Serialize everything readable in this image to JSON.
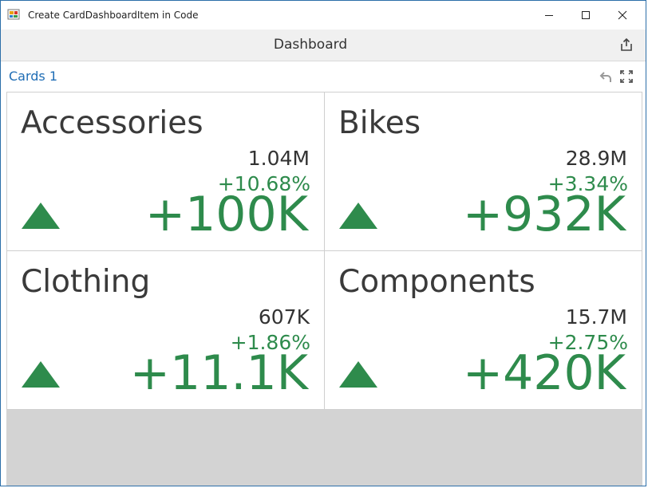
{
  "window": {
    "title": "Create CardDashboardItem in Code"
  },
  "toolbar": {
    "title": "Dashboard"
  },
  "item": {
    "title": "Cards 1"
  },
  "colors": {
    "positive": "#2e8b4c",
    "accent": "#1f6db5"
  },
  "cards": [
    {
      "name": "Accessories",
      "actual": "1.04M",
      "percent": "+10.68%",
      "absolute": "+100K",
      "trend": "up"
    },
    {
      "name": "Bikes",
      "actual": "28.9M",
      "percent": "+3.34%",
      "absolute": "+932K",
      "trend": "up"
    },
    {
      "name": "Clothing",
      "actual": "607K",
      "percent": "+1.86%",
      "absolute": "+11.1K",
      "trend": "up"
    },
    {
      "name": "Components",
      "actual": "15.7M",
      "percent": "+2.75%",
      "absolute": "+420K",
      "trend": "up"
    }
  ]
}
